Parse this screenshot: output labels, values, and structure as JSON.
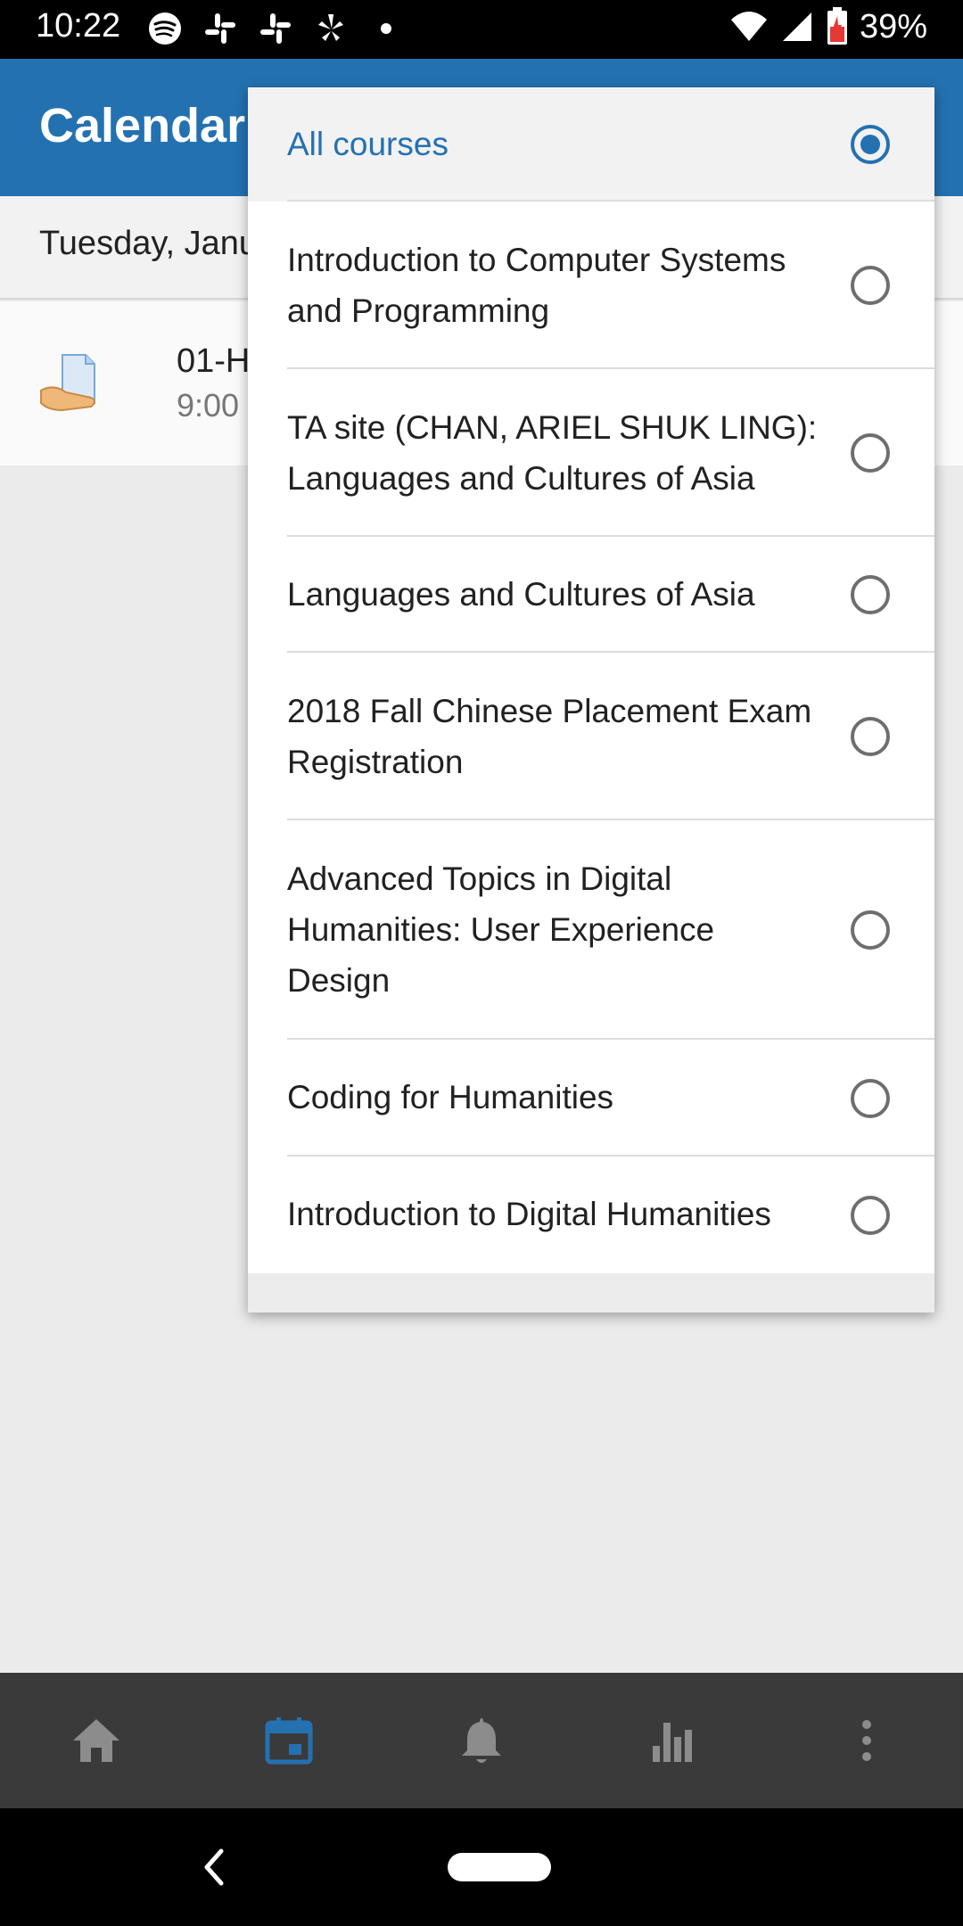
{
  "status_bar": {
    "time": "10:22",
    "battery": "39%",
    "left_icons": [
      "spotify-icon",
      "slack-icon",
      "slack-icon",
      "yelp-icon",
      "dot-icon"
    ],
    "right_icons": [
      "wifi-icon",
      "signal-icon",
      "battery-icon"
    ]
  },
  "app_bar": {
    "title": "Calendar"
  },
  "date_row": {
    "text": "Tuesday, Janu"
  },
  "event": {
    "title": "01-H",
    "time": "9:00",
    "icon": "assignment-icon"
  },
  "dropdown": {
    "options": [
      {
        "label": "All courses",
        "selected": true
      },
      {
        "label": "Introduction to Computer Systems and Programming",
        "selected": false
      },
      {
        "label": "TA site (CHAN, ARIEL SHUK LING): Languages and Cultures of Asia",
        "selected": false
      },
      {
        "label": "Languages and Cultures of Asia",
        "selected": false
      },
      {
        "label": "2018 Fall Chinese Placement Exam Registration",
        "selected": false
      },
      {
        "label": "Advanced Topics in Digital Humanities: User Experience Design",
        "selected": false
      },
      {
        "label": "Coding for Humanities",
        "selected": false
      },
      {
        "label": "Introduction to Digital Humanities",
        "selected": false
      }
    ]
  },
  "bottom_nav": {
    "items": [
      "home-icon",
      "calendar-icon",
      "notifications-icon",
      "grades-icon",
      "more-icon"
    ],
    "active": "calendar-icon",
    "colors": {
      "active": "#2471b1",
      "inactive": "#8c8c8c"
    }
  },
  "colors": {
    "brand": "#2471b1"
  }
}
